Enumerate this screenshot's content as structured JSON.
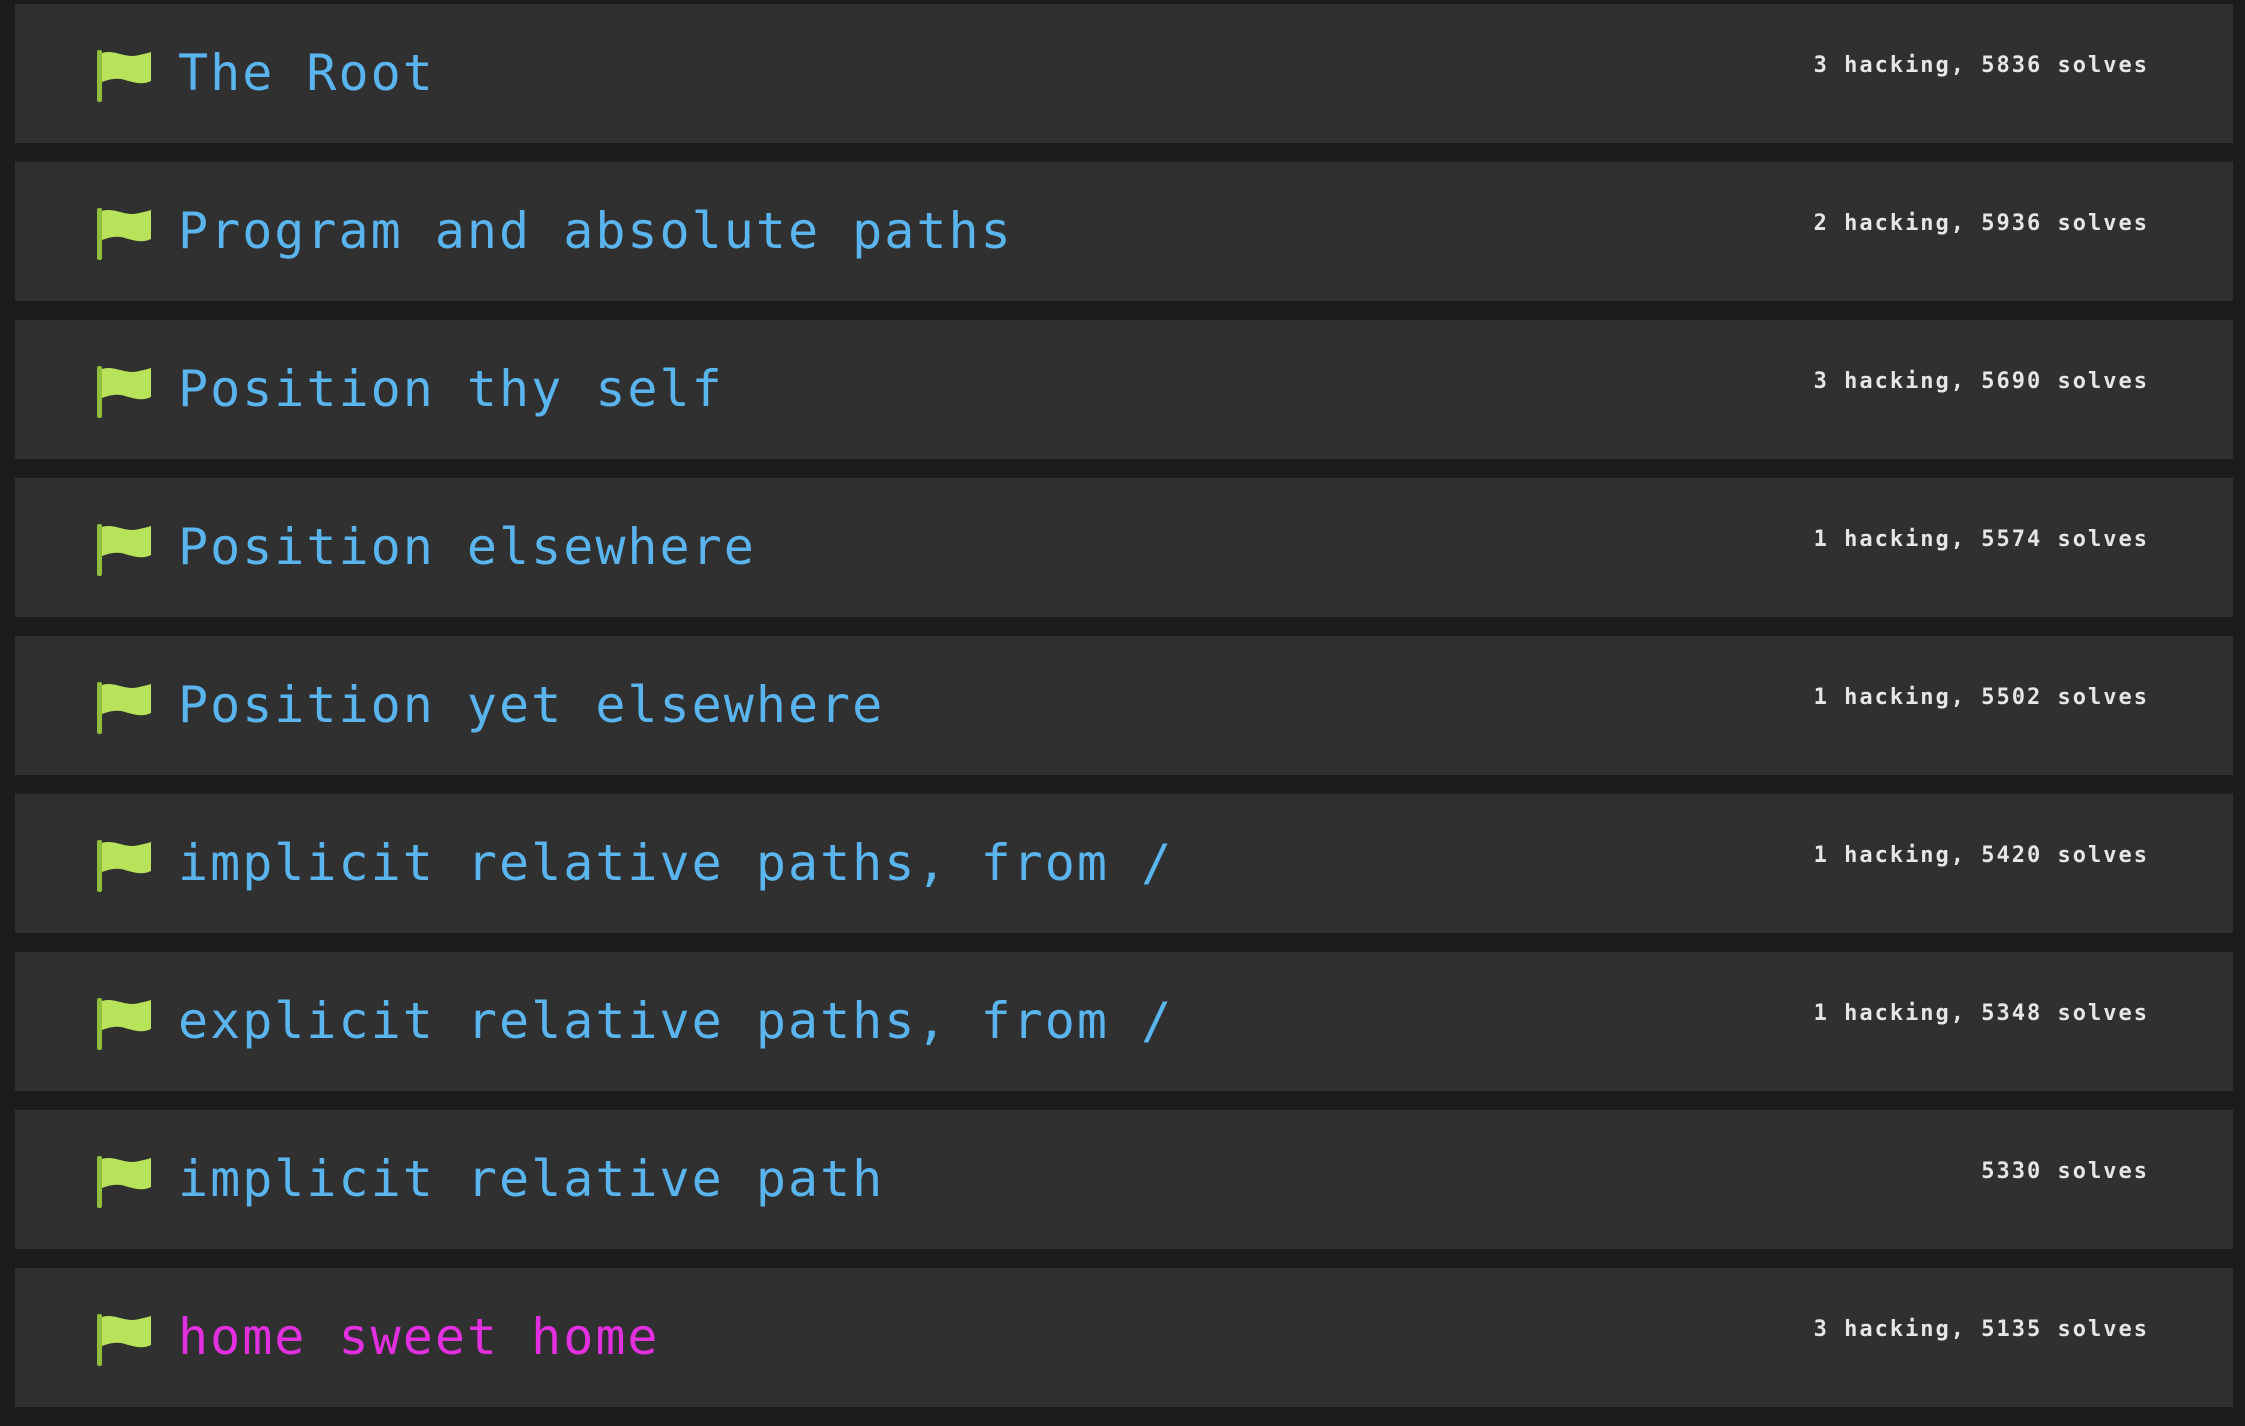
{
  "colors": {
    "page_bg": "#1c1c1c",
    "row_bg": "#303030",
    "title_default": "#5ab4ee",
    "title_active": "#e22fe0",
    "flag": "#b7e25a",
    "stats": "#e6e6e6"
  },
  "icon": "flag-icon",
  "challenges": [
    {
      "title": "The Root",
      "stats": "3 hacking, 5836 solves",
      "active": false
    },
    {
      "title": "Program and absolute paths",
      "stats": "2 hacking, 5936 solves",
      "active": false
    },
    {
      "title": "Position thy self",
      "stats": "3 hacking, 5690 solves",
      "active": false
    },
    {
      "title": "Position elsewhere",
      "stats": "1 hacking, 5574 solves",
      "active": false
    },
    {
      "title": "Position yet elsewhere",
      "stats": "1 hacking, 5502 solves",
      "active": false
    },
    {
      "title": "implicit relative paths, from /",
      "stats": "1 hacking, 5420 solves",
      "active": false
    },
    {
      "title": "explicit relative paths, from /",
      "stats": "1 hacking, 5348 solves",
      "active": false
    },
    {
      "title": "implicit relative path",
      "stats": "5330 solves",
      "active": false
    },
    {
      "title": "home sweet home",
      "stats": "3 hacking, 5135 solves",
      "active": true
    }
  ]
}
